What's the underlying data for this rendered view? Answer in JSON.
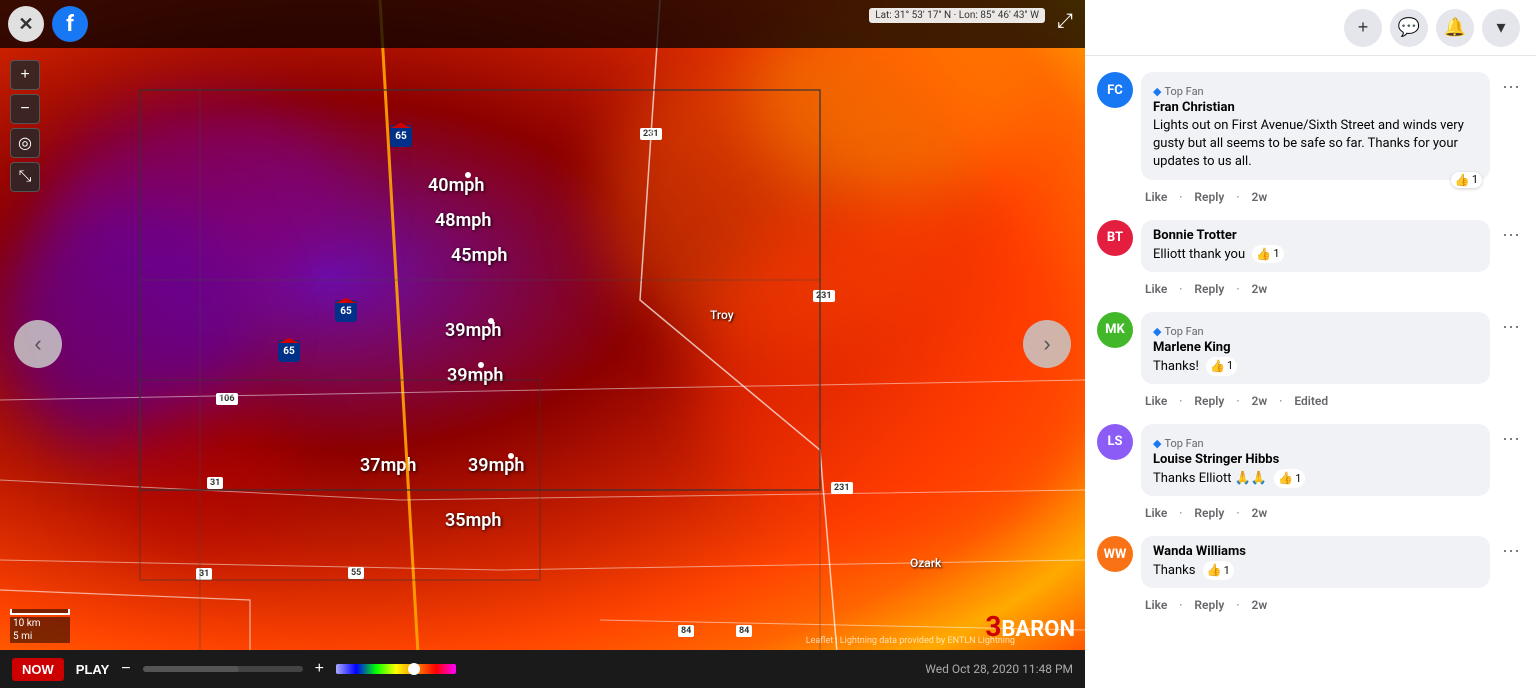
{
  "map": {
    "close_label": "✕",
    "expand_label": "⤢",
    "coords": "Lat: 31° 53' 17\" N · Lon: 85° 46' 43\" W",
    "now_label": "NOW",
    "play_label": "PLAY",
    "timestamp": "Wed Oct 28, 2020 11:48 PM",
    "scale_10km": "10 km",
    "scale_5mi": "5 mi",
    "baron_label": "BARON",
    "attribution": "Leaflet | Lightning data provided by ENTLN Lightning",
    "speeds": [
      {
        "label": "40mph",
        "top": "175",
        "left": "428"
      },
      {
        "label": "48mph",
        "top": "210",
        "left": "435"
      },
      {
        "label": "45mph",
        "top": "245",
        "left": "451"
      },
      {
        "label": "39mph",
        "top": "320",
        "left": "445"
      },
      {
        "label": "39mph",
        "top": "360",
        "left": "450"
      },
      {
        "label": "37mph",
        "top": "452",
        "left": "360"
      },
      {
        "label": "39mph",
        "top": "452",
        "left": "468"
      },
      {
        "label": "35mph",
        "top": "505",
        "left": "445"
      }
    ],
    "dots": [
      {
        "top": "175",
        "left": "468"
      },
      {
        "top": "320",
        "left": "490"
      },
      {
        "top": "360",
        "left": "480"
      },
      {
        "top": "452",
        "left": "510"
      }
    ],
    "places": [
      {
        "label": "Troy",
        "top": "310",
        "left": "710"
      },
      {
        "label": "Ozark",
        "top": "558",
        "left": "910"
      }
    ],
    "highways": [
      {
        "label": "65",
        "top": "125",
        "left": "390"
      },
      {
        "label": "65",
        "top": "300",
        "left": "335"
      },
      {
        "label": "65",
        "top": "340",
        "left": "280"
      }
    ],
    "route_labels": [
      {
        "label": "231",
        "top": "130",
        "left": "640"
      },
      {
        "label": "231",
        "top": "293",
        "left": "815"
      },
      {
        "label": "231",
        "top": "485",
        "left": "833"
      },
      {
        "label": "106",
        "top": "395",
        "left": "218"
      },
      {
        "label": "31",
        "top": "480",
        "left": "209"
      },
      {
        "label": "55",
        "top": "567",
        "left": "348"
      },
      {
        "label": "84",
        "top": "626",
        "left": "678"
      },
      {
        "label": "84",
        "top": "626",
        "left": "736"
      },
      {
        "label": "31",
        "top": "570",
        "left": "198"
      }
    ]
  },
  "facebook": {
    "topbar_buttons": [
      "+",
      "💬",
      "🔔",
      "▾"
    ],
    "comments": [
      {
        "id": "c1",
        "avatar_color": "av-blue",
        "avatar_initials": "FC",
        "top_fan": true,
        "author": "Fran Christian",
        "text": "Lights out on First Avenue/Sixth Street and winds very gusty but all seems to be safe so far. Thanks for your updates to us all.",
        "like_count": "1",
        "actions": [
          "Like",
          "Reply",
          "2w"
        ],
        "has_more": true
      },
      {
        "id": "c2",
        "avatar_color": "av-red",
        "avatar_initials": "BT",
        "top_fan": false,
        "author": "Bonnie Trotter",
        "text": "Elliott thank you",
        "like_count": "1",
        "actions": [
          "Like",
          "Reply",
          "2w"
        ],
        "has_more": true
      },
      {
        "id": "c3",
        "avatar_color": "av-green",
        "avatar_initials": "MK",
        "top_fan": true,
        "author": "Marlene King",
        "text": "Thanks!",
        "like_count": "1",
        "actions": [
          "Like",
          "Reply",
          "2w",
          "Edited"
        ],
        "has_more": true
      },
      {
        "id": "c4",
        "avatar_color": "av-purple",
        "avatar_initials": "LS",
        "top_fan": true,
        "author": "Louise Stringer Hibbs",
        "text": "Thanks Elliott 🙏🙏",
        "like_count": "1",
        "actions": [
          "Like",
          "Reply",
          "2w"
        ],
        "has_more": true
      },
      {
        "id": "c5",
        "avatar_color": "av-orange",
        "avatar_initials": "WW",
        "top_fan": false,
        "author": "Wanda Williams",
        "text": "Thanks",
        "like_count": "1",
        "actions": [
          "Like",
          "Reply",
          "2w"
        ],
        "has_more": true
      }
    ]
  }
}
